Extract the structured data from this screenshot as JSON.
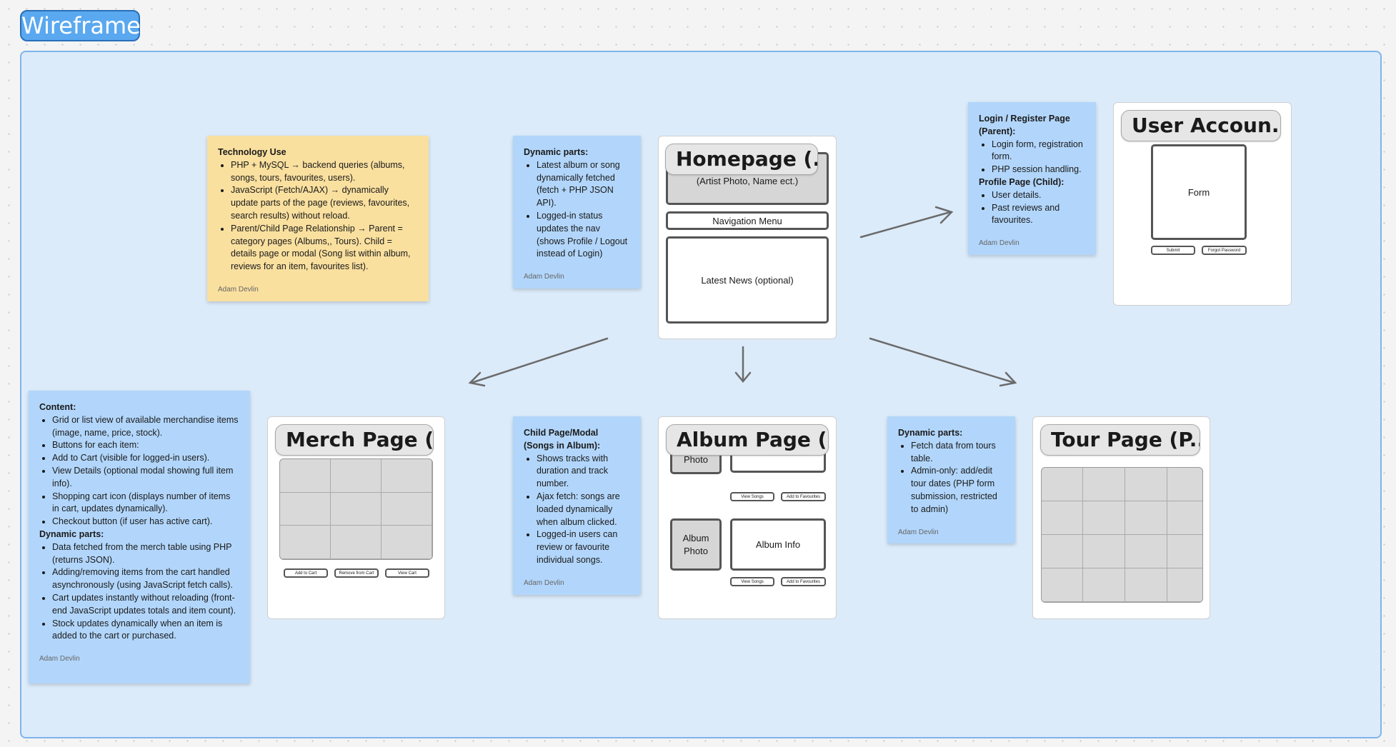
{
  "section": {
    "label": "Wireframe"
  },
  "notes": {
    "technology": {
      "title": "Technology Use",
      "items": [
        "PHP + MySQL → backend queries (albums, songs, tours, favourites, users).",
        "JavaScript (Fetch/AJAX) → dynamically update parts of the page (reviews, favourites, search results) without reload.",
        "Parent/Child Page Relationship → Parent = category pages (Albums,, Tours). Child = details page or modal (Song list within album, reviews for an item, favourites list)."
      ],
      "author": "Adam Devlin"
    },
    "home_dynamic": {
      "title": "Dynamic parts:",
      "items": [
        "Latest album or song dynamically fetched (fetch + PHP JSON API).",
        "Logged-in status updates the nav (shows Profile / Logout instead of Login)"
      ],
      "author": "Adam Devlin"
    },
    "login": {
      "title1": "Login / Register Page (Parent):",
      "items1": [
        "Login form, registration form.",
        "PHP session handling."
      ],
      "title2": "Profile Page (Child):",
      "items2": [
        "User details.",
        "Past reviews and favourites."
      ],
      "author": "Adam Devlin"
    },
    "merch": {
      "title1": "Content:",
      "items1": [
        "Grid or list view of available merchandise items (image, name, price, stock).",
        "Buttons for each item:",
        "Add to Cart (visible for logged-in users).",
        "View Details (optional modal showing full item info).",
        "Shopping cart icon (displays number of items in cart, updates dynamically).",
        "Checkout button (if user has active cart)."
      ],
      "title2": "Dynamic parts:",
      "items2": [
        "Data fetched from the merch table using PHP (returns JSON).",
        "Adding/removing items from the cart handled asynchronously (using JavaScript fetch calls).",
        "Cart updates instantly without reloading (front-end JavaScript updates totals and item count).",
        "Stock updates dynamically when an item is added to the cart or purchased."
      ],
      "author": "Adam Devlin"
    },
    "album": {
      "title": "Child Page/Modal (Songs in Album):",
      "items": [
        "Shows tracks with duration and track number.",
        "Ajax fetch: songs are loaded dynamically when album clicked.",
        "Logged-in users can review or favourite individual songs."
      ],
      "author": "Adam Devlin"
    },
    "tour": {
      "title": "Dynamic parts:",
      "items": [
        "Fetch data from tours table.",
        "Admin-only: add/edit tour dates (PHP form submission, restricted to admin)"
      ],
      "author": "Adam Devlin"
    }
  },
  "frames": {
    "homepage": {
      "title": "Homepage (...",
      "hero": "(Artist Photo, Name ect.)",
      "nav": "Navigation Menu",
      "news": "Latest News (optional)"
    },
    "account": {
      "title": "User Accoun...",
      "form": "Form",
      "submit": "Submit",
      "forgot": "Forgot Password"
    },
    "merch": {
      "title": "Merch Page (...",
      "add": "Add to Cart",
      "remove": "Remove from Cart",
      "view": "View Cart"
    },
    "album": {
      "title": "Album Page (...",
      "photo1": "Photo",
      "info1": "Album Info",
      "photo2": "Album Photo",
      "info2": "Album Info",
      "view_songs": "View Songs",
      "add_fav": "Add to Favourites"
    },
    "tour": {
      "title": "Tour Page (P..."
    }
  }
}
